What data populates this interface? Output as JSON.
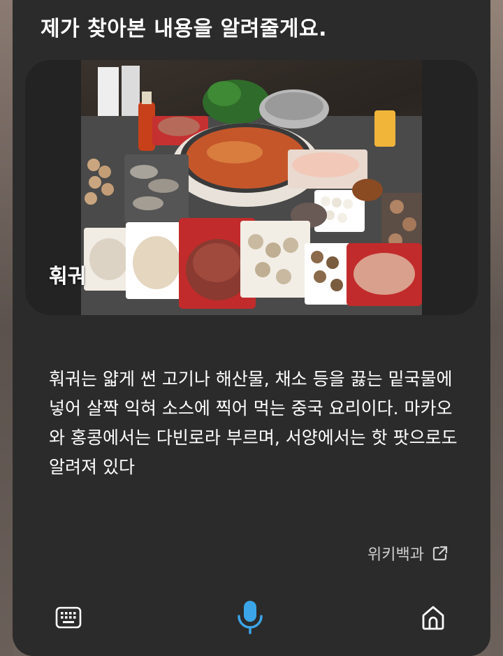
{
  "heading": "제가 찾아본 내용을 알려줄게요.",
  "card": {
    "label": "훠궈",
    "image_icon": "hotpot-photo"
  },
  "description": "훠궈는 얇게 썬 고기나 해산물, 채소 등을 끓는 밑국물에 넣어 살짝 익혀 소스에 찍어 먹는 중국 요리이다. 마카오와 홍콩에서는 다빈로라 부르며, 서양에서는 핫 팟으로도 알려져 있다",
  "source": {
    "label": "위키백과",
    "icon": "external-link-icon"
  },
  "bottom_bar": {
    "keyboard_icon": "keyboard-icon",
    "mic_icon": "microphone-icon",
    "home_icon": "home-icon"
  },
  "colors": {
    "sheet_bg": "#2b2b2b",
    "card_bg": "#232323",
    "mic_accent": "#3ba5e8",
    "text": "#ffffff"
  }
}
